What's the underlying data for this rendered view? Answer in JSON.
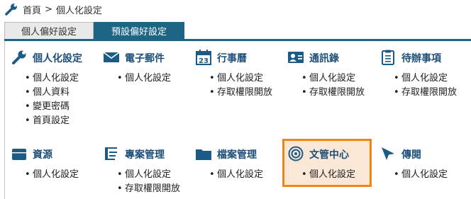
{
  "breadcrumb": {
    "home": "首頁",
    "separator": ">",
    "current": "個人化設定"
  },
  "tabs": [
    {
      "label": "個人偏好設定",
      "active": false
    },
    {
      "label": "預設偏好設定",
      "active": true
    }
  ],
  "colors": {
    "accent": "#1c6584",
    "title": "#1c4f7a",
    "highlight_border": "#ef8419",
    "highlight_fill": "#fbe7d6"
  },
  "cards": [
    {
      "title": "個人化設定",
      "icon": "wrench-icon",
      "items": [
        "個人化設定",
        "個人資料",
        "變更密碼",
        "首頁設定"
      ]
    },
    {
      "title": "電子郵件",
      "icon": "envelope-icon",
      "items": [
        "個人化設定"
      ]
    },
    {
      "title": "行事曆",
      "icon": "calendar-icon",
      "icon_text": "23",
      "items": [
        "個人化設定",
        "存取權限開放"
      ]
    },
    {
      "title": "通訊錄",
      "icon": "contact-card-icon",
      "items": [
        "個人化設定",
        "存取權限開放"
      ]
    },
    {
      "title": "待辦事項",
      "icon": "clipboard-icon",
      "items": [
        "個人化設定",
        "存取權限開放"
      ]
    },
    {
      "title": "資源",
      "icon": "box-icon",
      "items": [
        "個人化設定"
      ]
    },
    {
      "title": "專案管理",
      "icon": "project-icon",
      "items": [
        "個人化設定",
        "存取權限開放"
      ]
    },
    {
      "title": "檔案管理",
      "icon": "folder-icon",
      "items": [
        "個人化設定"
      ]
    },
    {
      "title": "文管中心",
      "icon": "target-icon",
      "items": [
        "個人化設定"
      ],
      "highlighted": true
    },
    {
      "title": "傳閱",
      "icon": "cursor-arrow-icon",
      "items": [
        "個人化設定"
      ]
    }
  ]
}
